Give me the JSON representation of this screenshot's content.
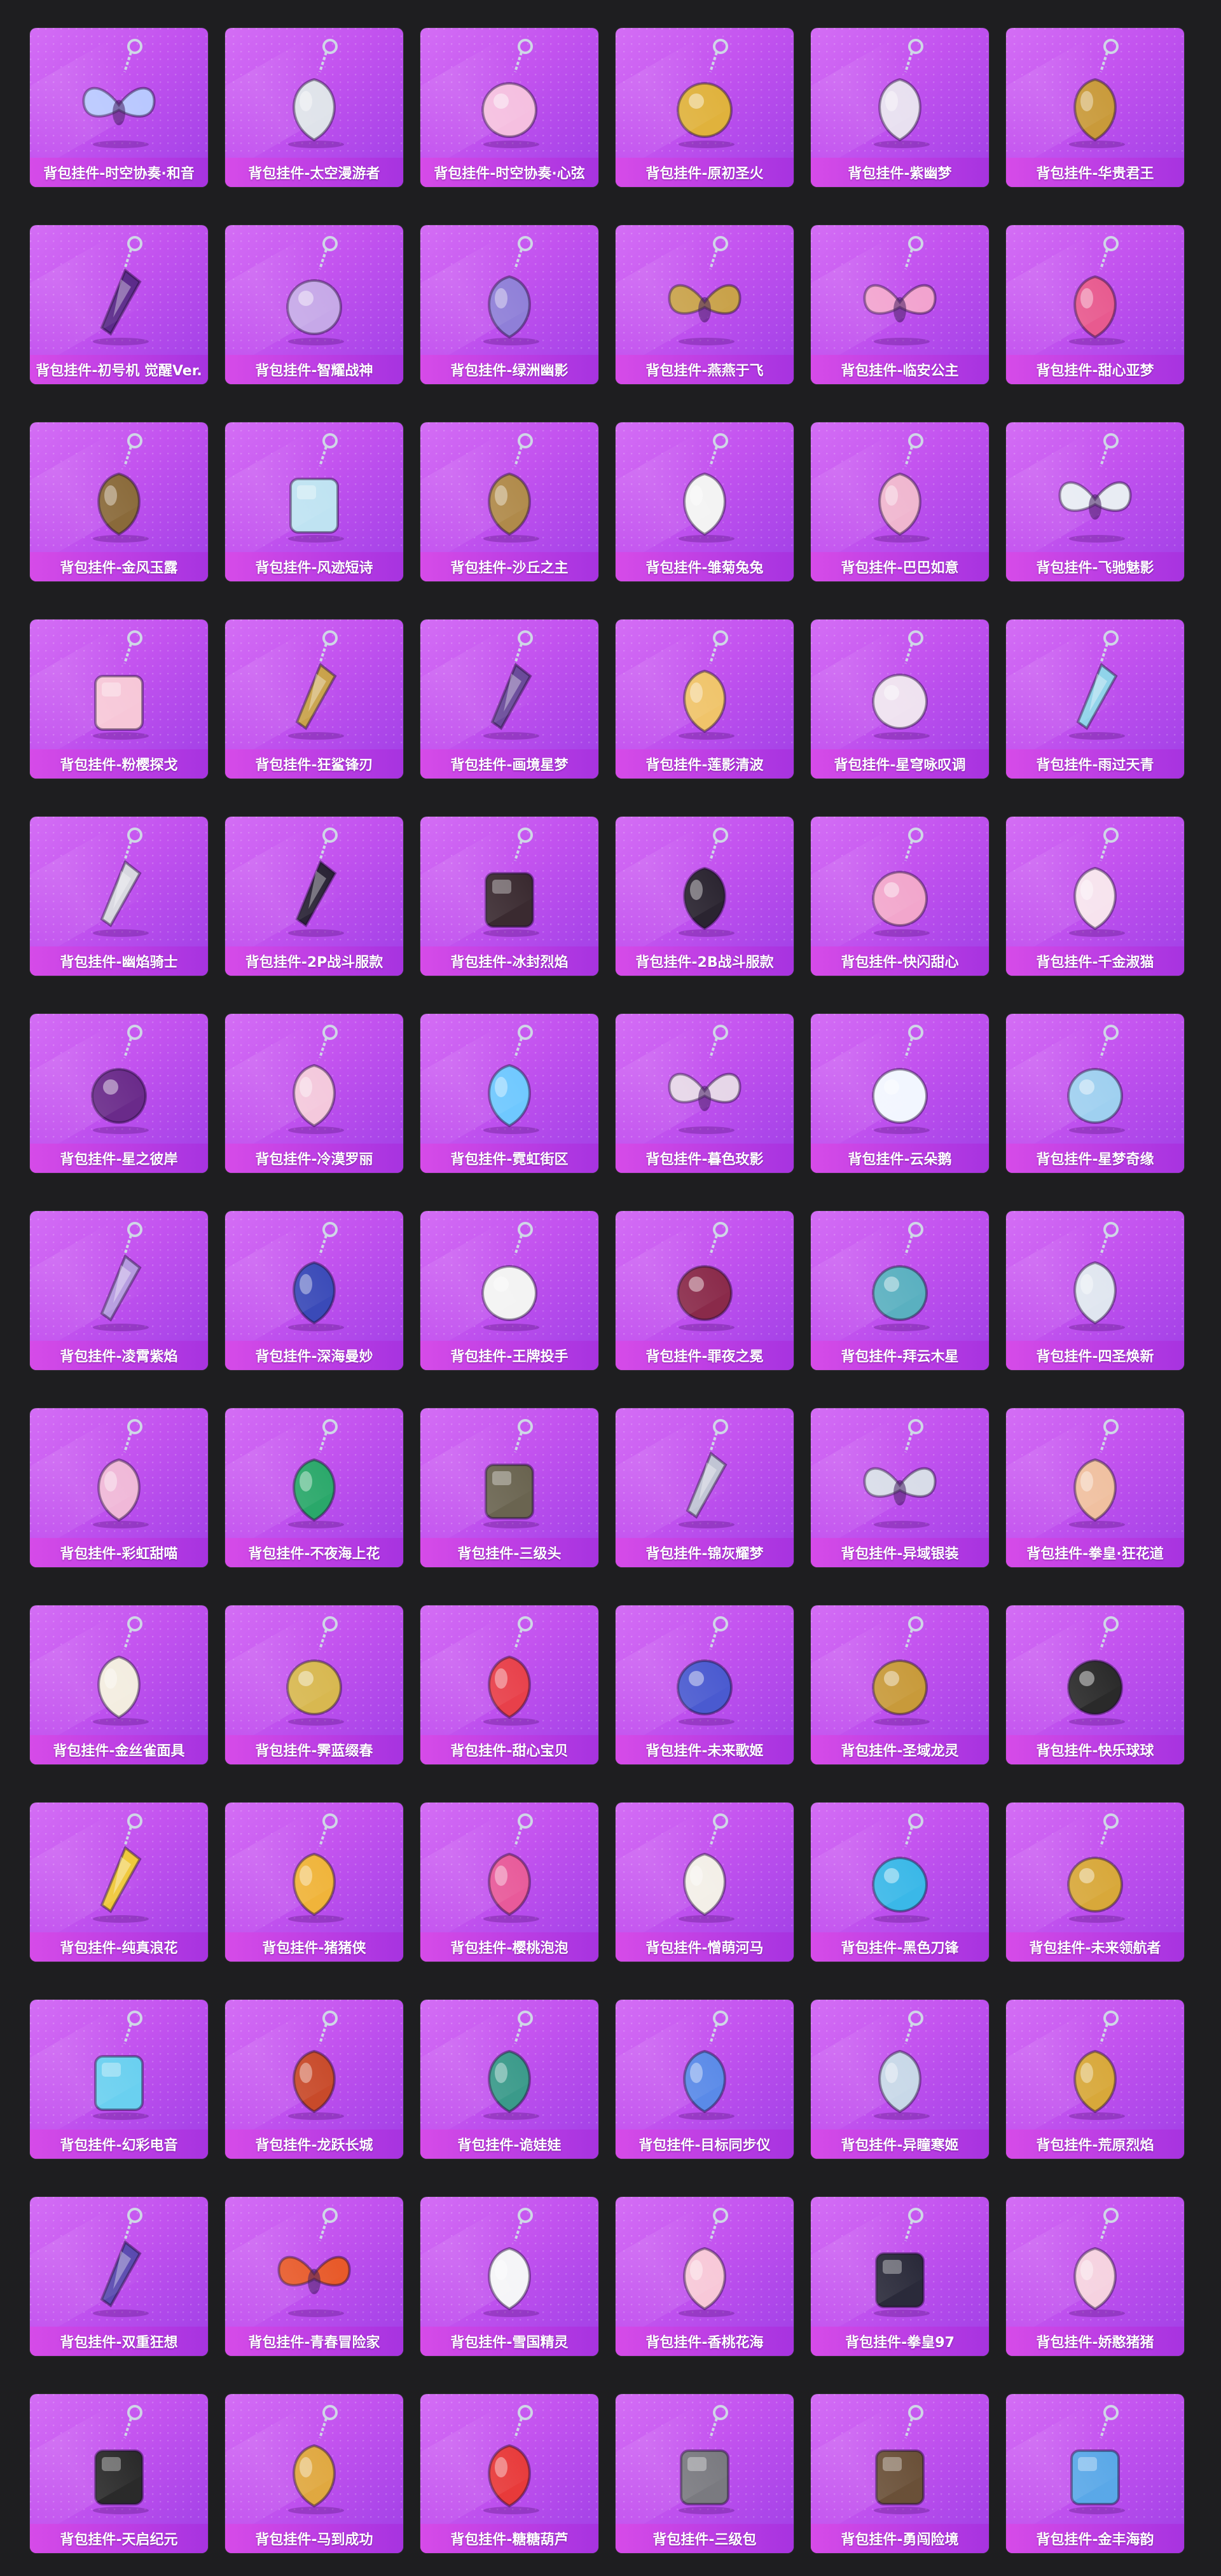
{
  "colors": {
    "page_background": "#1e1e20",
    "card_gradient_start": "#d46ef5",
    "card_gradient_end": "#9f3fe6",
    "label_bar_start": "#d64be8",
    "label_bar_end": "#a733e0",
    "label_text": "#ffffff"
  },
  "items": [
    {
      "label": "背包挂件-时空协奏·和音",
      "icon": "crystal-wing-charm-icon",
      "color": "#b9c8ff"
    },
    {
      "label": "背包挂件-太空漫游者",
      "icon": "astronaut-charm-icon",
      "color": "#dfe3ea"
    },
    {
      "label": "背包挂件-时空协奏·心弦",
      "icon": "pink-heart-charm-icon",
      "color": "#f5bfe0"
    },
    {
      "label": "背包挂件-原初圣火",
      "icon": "gold-emblem-charm-icon",
      "color": "#e0b23c"
    },
    {
      "label": "背包挂件-紫幽梦",
      "icon": "small-bell-charm-icon",
      "color": "#e8e0f0"
    },
    {
      "label": "背包挂件-华贵君王",
      "icon": "gold-chess-king-charm-icon",
      "color": "#c99a3a"
    },
    {
      "label": "背包挂件-初号机 觉醒Ver.",
      "icon": "purple-blade-charm-icon",
      "color": "#5b2a8a"
    },
    {
      "label": "背包挂件-智耀战神",
      "icon": "star-ring-charm-icon",
      "color": "#c6a8e8"
    },
    {
      "label": "背包挂件-绿洲幽影",
      "icon": "gem-charm-icon",
      "color": "#8f7fd8"
    },
    {
      "label": "背包挂件-燕燕于飞",
      "icon": "swallow-charm-icon",
      "color": "#c9a24a"
    },
    {
      "label": "背包挂件-临安公主",
      "icon": "pink-butterfly-charm-icon",
      "color": "#f2a3cf"
    },
    {
      "label": "背包挂件-甜心亚梦",
      "icon": "paw-charm-icon",
      "color": "#e85a8f"
    },
    {
      "label": "背包挂件-金风玉露",
      "icon": "tassel-charm-icon",
      "color": "#8a6a3a"
    },
    {
      "label": "背包挂件-风迹短诗",
      "icon": "envelope-charm-icon",
      "color": "#bfe3f2"
    },
    {
      "label": "背包挂件-沙丘之主",
      "icon": "amber-crystal-charm-icon",
      "color": "#b08a4a"
    },
    {
      "label": "背包挂件-雏菊兔兔",
      "icon": "bunny-charm-icon",
      "color": "#f3f3f3"
    },
    {
      "label": "背包挂件-巴巴如意",
      "icon": "pink-mouse-charm-icon",
      "color": "#f0b6cf"
    },
    {
      "label": "背包挂件-飞驰魅影",
      "icon": "winged-eye-charm-icon",
      "color": "#e8ecf3"
    },
    {
      "label": "背包挂件-粉樱探戈",
      "icon": "pink-letter-charm-icon",
      "color": "#f7c7d8"
    },
    {
      "label": "背包挂件-狂鲨锋刃",
      "icon": "gold-fin-charm-icon",
      "color": "#c9a24a"
    },
    {
      "label": "背包挂件-画境星梦",
      "icon": "staff-charm-icon",
      "color": "#6a4a9a"
    },
    {
      "label": "背包挂件-莲影清波",
      "icon": "gold-flower-charm-icon",
      "color": "#f0c46a"
    },
    {
      "label": "背包挂件-星穹咏叹调",
      "icon": "round-charm-icon",
      "color": "#efe2f0"
    },
    {
      "label": "背包挂件-雨过天青",
      "icon": "blue-pen-charm-icon",
      "color": "#8fd3ea"
    },
    {
      "label": "背包挂件-幽焰骑士",
      "icon": "sword-charm-icon",
      "color": "#d8d8e0"
    },
    {
      "label": "背包挂件-2P战斗服款",
      "icon": "dark-blade-charm-icon",
      "color": "#2a2436"
    },
    {
      "label": "背包挂件-冰封烈焰",
      "icon": "capsule-charm-icon",
      "color": "#3a2a30"
    },
    {
      "label": "背包挂件-2B战斗服款",
      "icon": "anchor-charm-icon",
      "color": "#2a2430"
    },
    {
      "label": "背包挂件-快闪甜心",
      "icon": "pink-compact-charm-icon",
      "color": "#f2a6cc"
    },
    {
      "label": "背包挂件-千金淑猫",
      "icon": "white-cat-charm-icon",
      "color": "#f7e3ee"
    },
    {
      "label": "背包挂件-星之彼岸",
      "icon": "planet-charm-icon",
      "color": "#6a2a8a"
    },
    {
      "label": "背包挂件-冷漠罗丽",
      "icon": "rose-charm-icon",
      "color": "#f4c8dc"
    },
    {
      "label": "背包挂件-霓虹街区",
      "icon": "neon-cake-charm-icon",
      "color": "#6fc8ff"
    },
    {
      "label": "背包挂件-暮色玫影",
      "icon": "bat-wing-charm-icon",
      "color": "#e6d6e8"
    },
    {
      "label": "背包挂件-云朵鹅",
      "icon": "duck-badge-charm-icon",
      "color": "#f2f6ff"
    },
    {
      "label": "背包挂件-星梦奇缘",
      "icon": "blue-jewel-charm-icon",
      "color": "#9fd0f0"
    },
    {
      "label": "背包挂件-凌霄紫焰",
      "icon": "flame-charm-icon",
      "color": "#b59ae0"
    },
    {
      "label": "背包挂件-深海曼妙",
      "icon": "submarine-charm-icon",
      "color": "#3a4ab8"
    },
    {
      "label": "背包挂件-王牌投手",
      "icon": "baseball-charm-icon",
      "color": "#f3f3f3"
    },
    {
      "label": "背包挂件-罪夜之冕",
      "icon": "bat-heart-charm-icon",
      "color": "#8a2a4a"
    },
    {
      "label": "背包挂件-拜云木星",
      "icon": "orb-charm-icon",
      "color": "#5ab0c0"
    },
    {
      "label": "背包挂件-四圣焕新",
      "icon": "rocket-charm-icon",
      "color": "#e0e6f0"
    },
    {
      "label": "背包挂件-彩虹甜喵",
      "icon": "pink-strap-charm-icon",
      "color": "#f0b8d8"
    },
    {
      "label": "背包挂件-不夜海上花",
      "icon": "jade-charm-icon",
      "color": "#2aa86a"
    },
    {
      "label": "背包挂件-三级头",
      "icon": "helmet-charm-icon",
      "color": "#6a6450"
    },
    {
      "label": "背包挂件-锦灰耀梦",
      "icon": "hammer-charm-icon",
      "color": "#c0c4d4"
    },
    {
      "label": "背包挂件-异域银装",
      "icon": "silver-wing-charm-icon",
      "color": "#d8dce8"
    },
    {
      "label": "背包挂件-拳皇·狂花道",
      "icon": "bead-tassel-charm-icon",
      "color": "#f0c0a0"
    },
    {
      "label": "背包挂件-金丝雀面具",
      "icon": "mask-charm-icon",
      "color": "#f3ede0"
    },
    {
      "label": "背包挂件-霁蓝缀春",
      "icon": "gold-ring-charm-icon",
      "color": "#d8b850"
    },
    {
      "label": "背包挂件-甜心宝贝",
      "icon": "lollipop-charm-icon",
      "color": "#e8404a"
    },
    {
      "label": "背包挂件-未来歌姬",
      "icon": "heart-bow-charm-icon",
      "color": "#4a5ad0"
    },
    {
      "label": "背包挂件-圣域龙灵",
      "icon": "gold-medallion-charm-icon",
      "color": "#c89a3a"
    },
    {
      "label": "背包挂件-快乐球球",
      "icon": "headphone-ball-charm-icon",
      "color": "#2a2a2a"
    },
    {
      "label": "背包挂件-纯真浪花",
      "icon": "yellow-key-charm-icon",
      "color": "#f0c83a"
    },
    {
      "label": "背包挂件-猪猪侠",
      "icon": "pig-hero-charm-icon",
      "color": "#f0b43a"
    },
    {
      "label": "背包挂件-樱桃泡泡",
      "icon": "cherry-charm-icon",
      "color": "#e85a9a"
    },
    {
      "label": "背包挂件-憎萌河马",
      "icon": "pearl-drop-charm-icon",
      "color": "#f3efe8"
    },
    {
      "label": "背包挂件-黑色刀锋",
      "icon": "badge-logo-charm-icon",
      "color": "#3ab8e8"
    },
    {
      "label": "背包挂件-未来领航者",
      "icon": "gold-coin-charm-icon",
      "color": "#d8a83a"
    },
    {
      "label": "背包挂件-幻彩电音",
      "icon": "cube-robot-charm-icon",
      "color": "#6ad0f0"
    },
    {
      "label": "背包挂件-龙跃长城",
      "icon": "lion-mask-charm-icon",
      "color": "#c84a2a"
    },
    {
      "label": "背包挂件-诡娃娃",
      "icon": "doll-charm-icon",
      "color": "#3a9a8a"
    },
    {
      "label": "背包挂件-目标同步仪",
      "icon": "blue-loop-charm-icon",
      "color": "#5a8ae8"
    },
    {
      "label": "背包挂件-异瞳寒姬",
      "icon": "silver-bell-charm-icon",
      "color": "#c8d8e8"
    },
    {
      "label": "背包挂件-荒原烈焰",
      "icon": "sun-charm-icon",
      "color": "#d8a83a"
    },
    {
      "label": "背包挂件-双重狂想",
      "icon": "spear-charm-icon",
      "color": "#5a4ab0"
    },
    {
      "label": "背包挂件-青春冒险家",
      "icon": "red-bird-charm-icon",
      "color": "#e85a2a"
    },
    {
      "label": "背包挂件-雪国精灵",
      "icon": "snowman-charm-icon",
      "color": "#f5f5f8"
    },
    {
      "label": "背包挂件-香桃花海",
      "icon": "peach-blossom-charm-icon",
      "color": "#f8c8d8"
    },
    {
      "label": "背包挂件-拳皇97",
      "icon": "arcade-charm-icon",
      "color": "#2a2a3a"
    },
    {
      "label": "背包挂件-娇憨猪猪",
      "icon": "pink-pig-charm-icon",
      "color": "#f6d2e0"
    },
    {
      "label": "背包挂件-天启纪元",
      "icon": "triangle-charm-icon",
      "color": "#2a2a2a"
    },
    {
      "label": "背包挂件-马到成功",
      "icon": "horse-charm-icon",
      "color": "#e0a840"
    },
    {
      "label": "背包挂件-糖糖葫芦",
      "icon": "candied-haw-charm-icon",
      "color": "#e83a3a"
    },
    {
      "label": "背包挂件-三级包",
      "icon": "backpack-charm-icon",
      "color": "#7a7a80"
    },
    {
      "label": "背包挂件-勇闯险境",
      "icon": "treasure-chest-charm-icon",
      "color": "#6a5038"
    },
    {
      "label": "背包挂件-金丰海韵",
      "icon": "blue-card-charm-icon",
      "color": "#5aa8e8"
    }
  ]
}
